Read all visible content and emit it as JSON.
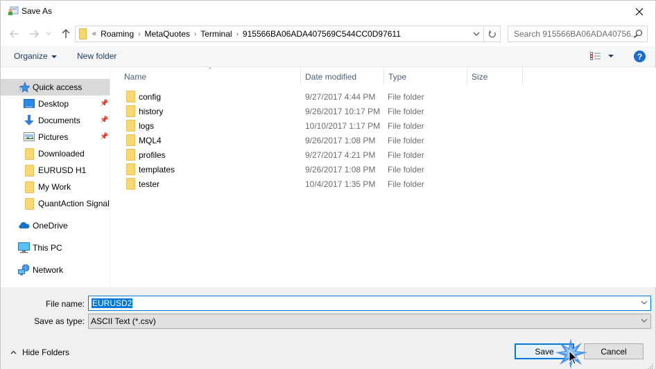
{
  "window": {
    "title": "Save As",
    "close_icon": "close-icon"
  },
  "nav": {
    "back_icon": "arrow-left-icon",
    "forward_icon": "arrow-right-icon",
    "recent_icon": "chevron-down-icon",
    "up_icon": "arrow-up-icon",
    "address_prefix": "«",
    "breadcrumbs": [
      "Roaming",
      "MetaQuotes",
      "Terminal",
      "915566BA06ADA407569C544CC0D97611"
    ],
    "refresh_icon": "refresh-icon",
    "search_placeholder": "Search 915566BA06ADA40756...",
    "search_icon": "search-icon"
  },
  "toolbar": {
    "organize_label": "Organize",
    "new_folder_label": "New folder",
    "view_icon": "details-view-icon",
    "help_label": "?"
  },
  "sidebar": {
    "items": [
      {
        "label": "Quick access",
        "icon": "star-icon",
        "selected": true,
        "pinned": false
      },
      {
        "label": "Desktop",
        "icon": "desktop-icon",
        "selected": false,
        "pinned": true
      },
      {
        "label": "Documents",
        "icon": "download-arrow-icon",
        "selected": false,
        "pinned": true
      },
      {
        "label": "Pictures",
        "icon": "pictures-icon",
        "selected": false,
        "pinned": true
      },
      {
        "label": "Downloaded",
        "icon": "folder-icon",
        "selected": false,
        "pinned": false
      },
      {
        "label": "EURUSD H1",
        "icon": "folder-icon",
        "selected": false,
        "pinned": false
      },
      {
        "label": "My Work",
        "icon": "folder-icon",
        "selected": false,
        "pinned": false
      },
      {
        "label": "QuantAction Signal",
        "icon": "folder-icon",
        "selected": false,
        "pinned": false
      },
      {
        "label": "OneDrive",
        "icon": "cloud-icon",
        "selected": false,
        "pinned": false
      },
      {
        "label": "This PC",
        "icon": "computer-icon",
        "selected": false,
        "pinned": false
      },
      {
        "label": "Network",
        "icon": "network-icon",
        "selected": false,
        "pinned": false
      }
    ]
  },
  "filelist": {
    "columns": [
      "Name",
      "Date modified",
      "Type",
      "Size"
    ],
    "sort_column": "Name",
    "rows": [
      {
        "name": "config",
        "date": "9/27/2017 4:44 PM",
        "type": "File folder",
        "size": ""
      },
      {
        "name": "history",
        "date": "9/26/2017 10:17 PM",
        "type": "File folder",
        "size": ""
      },
      {
        "name": "logs",
        "date": "10/10/2017 1:17 PM",
        "type": "File folder",
        "size": ""
      },
      {
        "name": "MQL4",
        "date": "9/26/2017 1:08 PM",
        "type": "File folder",
        "size": ""
      },
      {
        "name": "profiles",
        "date": "9/27/2017 4:21 PM",
        "type": "File folder",
        "size": ""
      },
      {
        "name": "templates",
        "date": "9/26/2017 1:08 PM",
        "type": "File folder",
        "size": ""
      },
      {
        "name": "tester",
        "date": "10/4/2017 1:35 PM",
        "type": "File folder",
        "size": ""
      }
    ]
  },
  "form": {
    "filename_label": "File name:",
    "filename_value": "EURUSD2",
    "savetype_label": "Save as type:",
    "savetype_value": "ASCII Text (*.csv)"
  },
  "footer": {
    "hide_folders_label": "Hide Folders",
    "save_label": "Save",
    "cancel_label": "Cancel"
  },
  "colors": {
    "accent": "#0078d7",
    "selected_row": "#d9d9d9",
    "toolbar_bg": "#f5f6f7",
    "footer_bg": "#f0f0f0",
    "folder_yellow": "#f8d775",
    "help_blue": "#1c6ccb"
  }
}
